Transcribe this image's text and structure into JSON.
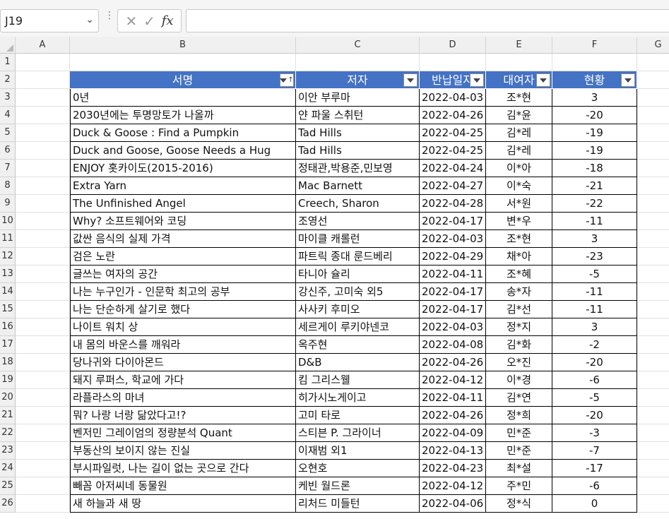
{
  "namebox": {
    "value": "J19"
  },
  "formula": {
    "fx_label": "fx",
    "value": ""
  },
  "columns": [
    "A",
    "B",
    "C",
    "D",
    "E",
    "F",
    "G"
  ],
  "row_numbers": [
    "1",
    "2",
    "3",
    "4",
    "5",
    "6",
    "7",
    "8",
    "9",
    "10",
    "11",
    "12",
    "13",
    "14",
    "15",
    "16",
    "17",
    "18",
    "19",
    "20",
    "21",
    "22",
    "23",
    "24",
    "25",
    "26"
  ],
  "table": {
    "headers": [
      "서명",
      "저자",
      "반납일자",
      "대여자",
      "현황"
    ],
    "rows": [
      [
        "0년",
        "이안 부루마",
        "2022-04-03",
        "조*현",
        "3"
      ],
      [
        "2030년에는 투명망토가 나올까",
        "얀 파울 스취턴",
        "2022-04-26",
        "김*윤",
        "-20"
      ],
      [
        "Duck & Goose : Find a Pumpkin",
        "Tad Hills",
        "2022-04-25",
        "김*레",
        "-19"
      ],
      [
        "Duck and Goose, Goose Needs a Hug",
        "Tad Hills",
        "2022-04-25",
        "김*레",
        "-19"
      ],
      [
        "ENJOY 홋카이도(2015-2016)",
        "정태관,박용준,민보영",
        "2022-04-24",
        "이*아",
        "-18"
      ],
      [
        "Extra Yarn",
        "Mac Barnett",
        "2022-04-27",
        "이*숙",
        "-21"
      ],
      [
        "The Unfinished Angel",
        "Creech, Sharon",
        "2022-04-28",
        "서*원",
        "-22"
      ],
      [
        "Why? 소프트웨어와 코딩",
        "조영선",
        "2022-04-17",
        "변*우",
        "-11"
      ],
      [
        "값싼 음식의 실제 가격",
        "마이클 캐롤런",
        "2022-04-03",
        "조*현",
        "3"
      ],
      [
        "검은 노란",
        "파트릭 종대 룬드베리",
        "2022-04-29",
        "채*아",
        "-23"
      ],
      [
        "글쓰는 여자의 공간",
        "타니아 슐리",
        "2022-04-11",
        "조*혜",
        "-5"
      ],
      [
        "나는 누구인가 - 인문학 최고의 공부",
        "강신주, 고미숙 외5",
        "2022-04-17",
        "송*자",
        "-11"
      ],
      [
        "나는 단순하게 살기로 했다",
        "사사키 후미오",
        "2022-04-17",
        "김*선",
        "-11"
      ],
      [
        "나이트 워치 상",
        "세르게이 루키야넨코",
        "2022-04-03",
        "정*지",
        "3"
      ],
      [
        "내 몸의 바운스를 깨워라",
        "옥주현",
        "2022-04-08",
        "김*화",
        "-2"
      ],
      [
        "당나귀와 다이아몬드",
        "D&B",
        "2022-04-26",
        "오*진",
        "-20"
      ],
      [
        "돼지 루퍼스, 학교에 가다",
        "킴 그리스웰",
        "2022-04-12",
        "이*경",
        "-6"
      ],
      [
        "라플라스의 마녀",
        "히가시노게이고",
        "2022-04-11",
        "김*연",
        "-5"
      ],
      [
        "뭐? 나랑 너랑 닮았다고!?",
        "고미 타로",
        "2022-04-26",
        "정*희",
        "-20"
      ],
      [
        "벤저민 그레이엄의 정량분석 Quant",
        "스티븐 P. 그라이너",
        "2022-04-09",
        "민*준",
        "-3"
      ],
      [
        "부동산의 보이지 않는 진실",
        "이재범 외1",
        "2022-04-13",
        "민*준",
        "-7"
      ],
      [
        "부시파일럿, 나는 길이 없는 곳으로 간다",
        "오현호",
        "2022-04-23",
        "최*설",
        "-17"
      ],
      [
        "빼꼼 아저씨네 동물원",
        "케빈 월드론",
        "2022-04-12",
        "주*민",
        "-6"
      ],
      [
        "새 하늘과 새 땅",
        "리처드 미들턴",
        "2022-04-06",
        "정*식",
        "0"
      ]
    ]
  }
}
